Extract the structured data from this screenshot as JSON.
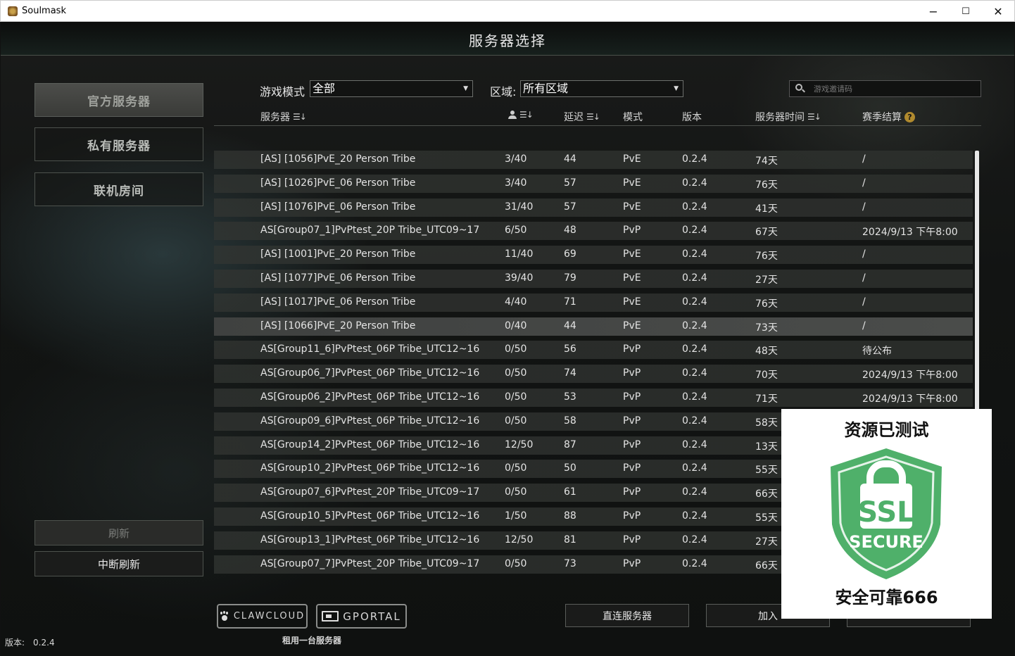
{
  "window": {
    "title": "Soulmask",
    "minimize": "−",
    "maximize": "☐",
    "close": "✕"
  },
  "header": {
    "title": "服务器选择"
  },
  "nav": {
    "official": "官方服务器",
    "private": "私有服务器",
    "lan": "联机房间",
    "refresh": "刷新",
    "stop_refresh": "中断刷新"
  },
  "filters": {
    "mode_label": "游戏模式",
    "mode_value": "全部",
    "region_label": "区域:",
    "region_value": "所有区域",
    "search_placeholder": "游戏邀请码"
  },
  "table": {
    "headers": {
      "server": "服务器",
      "ping": "延迟",
      "mode": "模式",
      "version": "版本",
      "server_time": "服务器时间",
      "season": "赛季结算"
    },
    "rows": [
      {
        "name": "[AS] [1056]PvE_20 Person Tribe",
        "players": "3/40",
        "ping": "44",
        "mode": "PvE",
        "version": "0.2.4",
        "time": "74天",
        "season": "/"
      },
      {
        "name": "[AS] [1026]PvE_06 Person Tribe",
        "players": "3/40",
        "ping": "57",
        "mode": "PvE",
        "version": "0.2.4",
        "time": "76天",
        "season": "/"
      },
      {
        "name": "[AS] [1076]PvE_06 Person Tribe",
        "players": "31/40",
        "ping": "57",
        "mode": "PvE",
        "version": "0.2.4",
        "time": "41天",
        "season": "/"
      },
      {
        "name": "AS[Group07_1]PvPtest_20P Tribe_UTC09~17",
        "players": "6/50",
        "ping": "48",
        "mode": "PvP",
        "version": "0.2.4",
        "time": "67天",
        "season": "2024/9/13 下午8:00"
      },
      {
        "name": "[AS] [1001]PvE_20 Person Tribe",
        "players": "11/40",
        "ping": "69",
        "mode": "PvE",
        "version": "0.2.4",
        "time": "76天",
        "season": "/"
      },
      {
        "name": "[AS] [1077]PvE_06 Person Tribe",
        "players": "39/40",
        "ping": "79",
        "mode": "PvE",
        "version": "0.2.4",
        "time": "27天",
        "season": "/"
      },
      {
        "name": "[AS] [1017]PvE_06 Person Tribe",
        "players": "4/40",
        "ping": "71",
        "mode": "PvE",
        "version": "0.2.4",
        "time": "76天",
        "season": "/"
      },
      {
        "name": "[AS] [1066]PvE_20 Person Tribe",
        "players": "0/40",
        "ping": "44",
        "mode": "PvE",
        "version": "0.2.4",
        "time": "73天",
        "season": "/"
      },
      {
        "name": "AS[Group11_6]PvPtest_06P Tribe_UTC12~16",
        "players": "0/50",
        "ping": "56",
        "mode": "PvP",
        "version": "0.2.4",
        "time": "48天",
        "season": "待公布"
      },
      {
        "name": "AS[Group06_7]PvPtest_06P Tribe_UTC12~16",
        "players": "0/50",
        "ping": "74",
        "mode": "PvP",
        "version": "0.2.4",
        "time": "70天",
        "season": "2024/9/13 下午8:00"
      },
      {
        "name": "AS[Group06_2]PvPtest_06P Tribe_UTC12~16",
        "players": "0/50",
        "ping": "53",
        "mode": "PvP",
        "version": "0.2.4",
        "time": "71天",
        "season": "2024/9/13 下午8:00"
      },
      {
        "name": "AS[Group09_6]PvPtest_06P Tribe_UTC12~16",
        "players": "0/50",
        "ping": "58",
        "mode": "PvP",
        "version": "0.2.4",
        "time": "58天",
        "season": ""
      },
      {
        "name": "AS[Group14_2]PvPtest_06P Tribe_UTC12~16",
        "players": "12/50",
        "ping": "87",
        "mode": "PvP",
        "version": "0.2.4",
        "time": "13天",
        "season": ""
      },
      {
        "name": "AS[Group10_2]PvPtest_06P Tribe_UTC12~16",
        "players": "0/50",
        "ping": "50",
        "mode": "PvP",
        "version": "0.2.4",
        "time": "55天",
        "season": ""
      },
      {
        "name": "AS[Group07_6]PvPtest_20P Tribe_UTC09~17",
        "players": "0/50",
        "ping": "61",
        "mode": "PvP",
        "version": "0.2.4",
        "time": "66天",
        "season": ""
      },
      {
        "name": "AS[Group10_5]PvPtest_06P Tribe_UTC12~16",
        "players": "1/50",
        "ping": "88",
        "mode": "PvP",
        "version": "0.2.4",
        "time": "55天",
        "season": ""
      },
      {
        "name": "AS[Group13_1]PvPtest_06P Tribe_UTC12~16",
        "players": "12/50",
        "ping": "81",
        "mode": "PvP",
        "version": "0.2.4",
        "time": "27天",
        "season": ""
      },
      {
        "name": "AS[Group07_7]PvPtest_20P Tribe_UTC09~17",
        "players": "0/50",
        "ping": "73",
        "mode": "PvP",
        "version": "0.2.4",
        "time": "66天",
        "season": ""
      }
    ]
  },
  "sponsors": {
    "claw": "CLAWCLOUD",
    "gportal": "GPORTAL",
    "caption": "租用一台服务器"
  },
  "actions": {
    "direct": "直连服务器",
    "join": "加入"
  },
  "version": {
    "label": "版本:",
    "value": "0.2.4"
  },
  "badge": {
    "title": "资源已测试",
    "ssl": "SSL",
    "secure": "SECURE",
    "caption": "安全可靠666",
    "color": "#4fb06a"
  }
}
